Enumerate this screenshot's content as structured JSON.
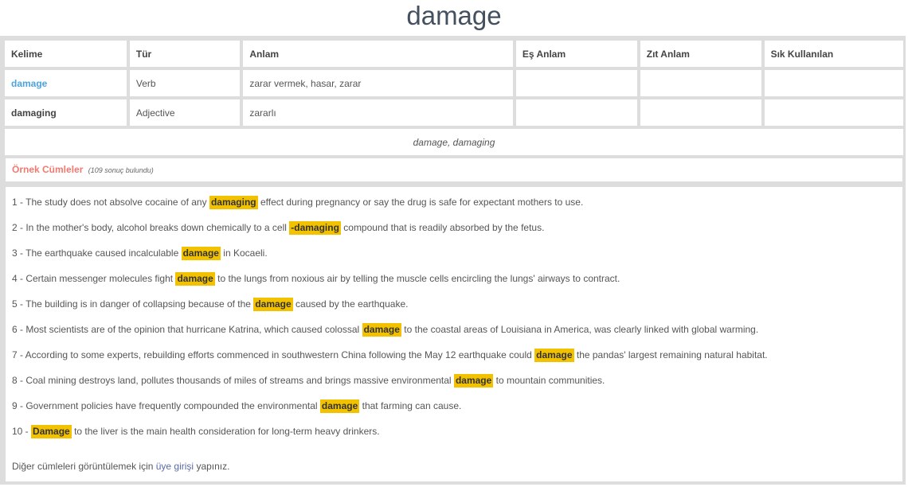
{
  "page": {
    "title": "damage"
  },
  "table": {
    "headers": [
      "Kelime",
      "Tür",
      "Anlam",
      "Eş Anlam",
      "Zıt Anlam",
      "Sık Kullanılan"
    ],
    "rows": [
      {
        "word": "damage",
        "type": "Verb",
        "meaning": "zarar vermek, hasar, zarar",
        "synonym": "",
        "antonym": "",
        "frequent": ""
      },
      {
        "word": "damaging",
        "type": "Adjective",
        "meaning": "zararlı",
        "synonym": "",
        "antonym": "",
        "frequent": ""
      }
    ],
    "forms": "damage, damaging"
  },
  "examples": {
    "title": "Örnek Cümleler",
    "count": "(109 sonuç bulundu)",
    "highlight_color": "#f2c200",
    "sentences": [
      {
        "prefix": "1 - The study does not absolve cocaine of any",
        "highlight": "damaging",
        "suffix": "effect during pregnancy or say the drug is safe for expectant mothers to use."
      },
      {
        "prefix": "2 - In the mother's body, alcohol breaks down chemically to a cell",
        "highlight": "-damaging",
        "suffix": "compound that is readily absorbed by the fetus."
      },
      {
        "prefix": "3 - The earthquake caused incalculable",
        "highlight": "damage",
        "suffix": "in Kocaeli."
      },
      {
        "prefix": "4 - Certain messenger molecules fight",
        "highlight": "damage",
        "suffix": "to the lungs from noxious air by telling the muscle cells encircling the lungs' airways to contract."
      },
      {
        "prefix": "5 - The building is in danger of collapsing because of the",
        "highlight": "damage",
        "suffix": "caused by the earthquake."
      },
      {
        "prefix": "6 - Most scientists are of the opinion that hurricane Katrina, which caused colossal",
        "highlight": "damage",
        "suffix": "to the coastal areas of Louisiana in America, was clearly linked with global warming."
      },
      {
        "prefix": "7 - According to some experts, rebuilding efforts commenced in southwestern China following the May 12 earthquake could",
        "highlight": "damage",
        "suffix": "the pandas' largest remaining natural habitat."
      },
      {
        "prefix": "8 - Coal mining destroys land, pollutes thousands of miles of streams and brings massive environmental",
        "highlight": "damage",
        "suffix": "to mountain communities."
      },
      {
        "prefix": "9 - Government policies have frequently compounded the environmental",
        "highlight": "damage",
        "suffix": "that farming can cause."
      },
      {
        "prefix": "10 -",
        "highlight": "Damage",
        "suffix": "to the liver is the main health consideration for long-term heavy drinkers."
      }
    ],
    "footer": {
      "before": "Diğer cümleleri görüntülemek için",
      "link": "üye girişi",
      "after": "yapınız."
    }
  }
}
